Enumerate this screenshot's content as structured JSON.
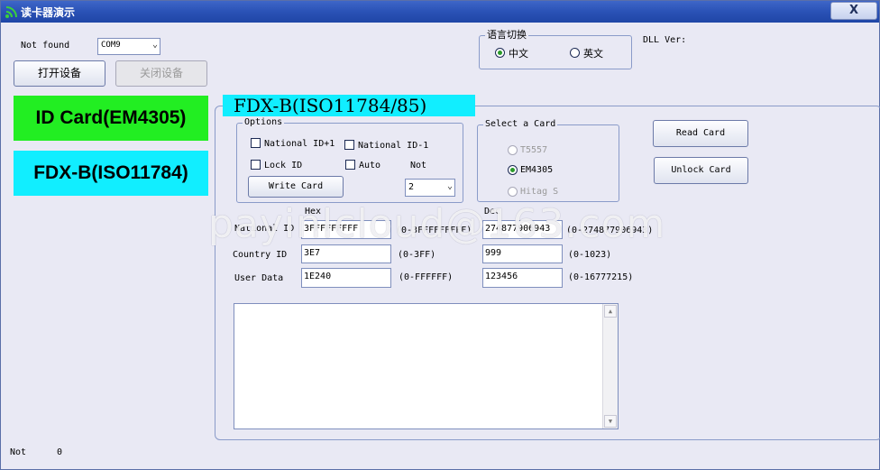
{
  "window": {
    "title": "读卡器演示",
    "close_label": "X"
  },
  "device": {
    "status": "Not found",
    "port": "COM9",
    "open_label": "打开设备",
    "close_label": "关闭设备",
    "dll_label": "DLL Ver:"
  },
  "language": {
    "group_title": "语言切换",
    "chinese": "中文",
    "english": "英文",
    "selected": "中文"
  },
  "nav": {
    "id_card": "ID Card(EM4305)",
    "fdxb": "FDX-B(ISO11784)"
  },
  "fdxb_panel": {
    "heading": "FDX-B(ISO11784/85)",
    "options": {
      "title": "Options",
      "national_id_plus1": "National ID+1",
      "national_id_minus1": "National ID-1",
      "lock_id": "Lock ID",
      "auto": "Auto",
      "not_label": "Not",
      "write_card": "Write Card",
      "count": "2"
    },
    "select_card": {
      "title": "Select a Card",
      "t5557": "T5557",
      "em4305": "EM4305",
      "hitag": "Hitag S",
      "selected": "EM4305"
    },
    "read_card": "Read Card",
    "unlock_card": "Unlock Card",
    "columns": {
      "hex": "Hex",
      "dec": "Dec"
    },
    "fields": [
      {
        "label": "National ID",
        "hex": "3FFFFFFFFF",
        "hex_range": "(0-3FFFFFFFFF)",
        "dec": "274877906943",
        "dec_range": "(0-274877906943)"
      },
      {
        "label": "Country ID",
        "hex": "3E7",
        "hex_range": "(0-3FF)",
        "dec": "999",
        "dec_range": "(0-1023)"
      },
      {
        "label": "User Data",
        "hex": "1E240",
        "hex_range": "(0-FFFFFF)",
        "dec": "123456",
        "dec_range": "(0-16777215)"
      }
    ]
  },
  "statusbar": {
    "label": "Not",
    "value": "0"
  },
  "watermark": "payinlcloud@163.com",
  "colors": {
    "id_card_bg": "#22ee22",
    "fdxb_bg": "#11eeff",
    "titlebar": "#2a52b6"
  }
}
